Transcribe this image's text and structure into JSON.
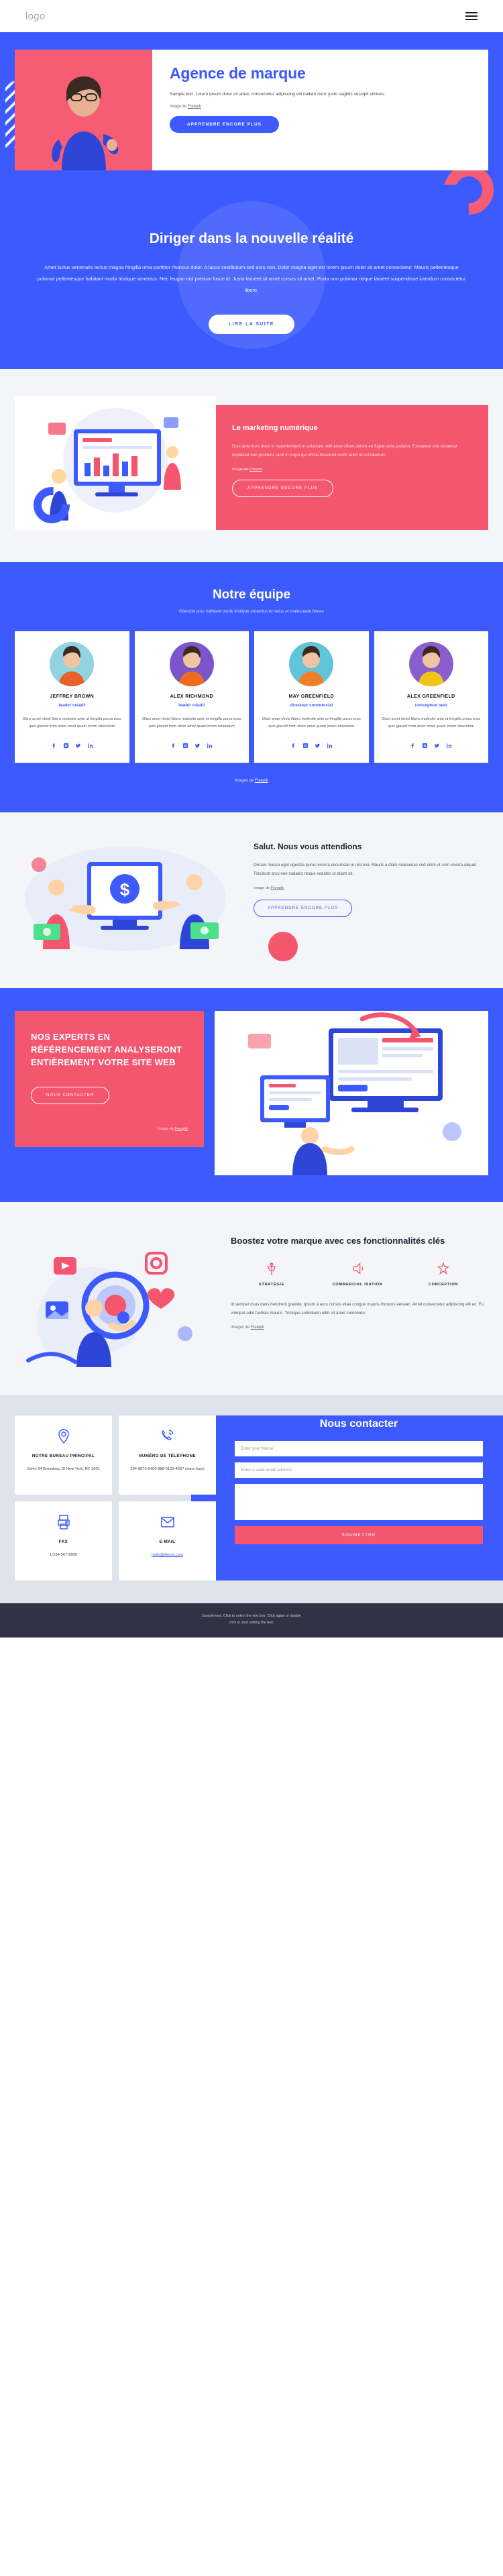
{
  "nav": {
    "logo": "logo",
    "menu_icon": "hamburger-icon"
  },
  "hero": {
    "title": "Agence de marque",
    "paragraph": "Sample text. Lorem ipsum dolor sit amet, consectetur adipiscing elit nullam nunc justo sagittis suscipit ultrices.",
    "credit_prefix": "Image de ",
    "credit_link": "Freepik",
    "cta": "APPRENDRE ENCORE PLUS"
  },
  "lead": {
    "title": "Diriger dans la nouvelle réalité",
    "paragraph": "Amet luctus venenatis lectus magna fringilla urna porttitor rhoncus dolor. A lacus vestibulum sed arcu non. Dolor magna eget est lorem ipsum dolor sit amet consectetur. Mauris pellentesque pulvinar pellentesque habitant morbi tristique senectus. Nec feugiat nisl pretium fusce id. Justo laoreet sit amet cursus sit amet. Porta non pulvinar neque laoreet suspendisse interdum consectetur libero.",
    "cta": "LIRE LA SUITE"
  },
  "marketing": {
    "title": "Le marketing numérique",
    "paragraph": "Duis aute irure dolor in reprehenderit in voluptate velit esse cillum dolore eu fugiat nulla pariatur. Excepteur sint occaecat cupidatat non proident, sunt in culpa qui officia deserunt mollit anim id est laborum.",
    "credit_prefix": "Image de ",
    "credit_link": "Freepik",
    "cta": "APPRENDRE ENCORE PLUS"
  },
  "team": {
    "title": "Notre équipe",
    "subtitle": "Glavrida pour habitant morbi tristique senectus et netus et malesuada fames",
    "credit_prefix": "Images de ",
    "credit_link": "Freepik",
    "members": [
      {
        "name": "JEFFREY BROWN",
        "role": "leader créatif",
        "bio": "Glavi amet ritnisl libero molestie ante ut fringilla purus eros quis glavrid from dolor amet quam lorem bibendum",
        "shirt": "#e8622b",
        "bg": "#8fd4e0"
      },
      {
        "name": "ALEX RICHMOND",
        "role": "leader créatif",
        "bio": "Glavi amet ritnisl libero molestie ante ut fringilla purus eros quis glavrid from dolor amet quam lorem bibendum",
        "shirt": "#ef6b1e",
        "bg": "#7b55c9"
      },
      {
        "name": "MAY GREENFIELD",
        "role": "directeur commercial",
        "bio": "Glavi amet ritnisl libero molestie ante ut fringilla purus eros quis glavrid from dolor amet quam lorem bibendum",
        "shirt": "#f07f2a",
        "bg": "#62c4d8"
      },
      {
        "name": "ALEX GREENFIELD",
        "role": "concepteur web",
        "bio": "Glavi amet ritnisl libero molestie ante ut fringilla purus eros quis glavrid from dolor amet quam lorem bibendum",
        "shirt": "#f0c419",
        "bg": "#8b5ed0"
      }
    ],
    "social_icons": [
      "facebook-icon",
      "instagram-icon",
      "twitter-icon",
      "linkedin-icon"
    ]
  },
  "salut": {
    "title": "Salut. Nous vous attendions",
    "paragraph": "Ornare massa eget egestas purus viverra accumsan in nisl nisi. Mauris a diam maecenas sed enim ut sem viverra aliquet. Tincidunt arcu non sodales neque sodales ut etiam sit.",
    "credit_prefix": "Image de ",
    "credit_link": "Freepik",
    "cta": "APPRENDRE ENCORE PLUS"
  },
  "seo": {
    "title": "NOS EXPERTS EN RÉFÉRENCEMENT ANALYSERONT ENTIÈREMENT VOTRE SITE WEB",
    "cta": "NOUS CONTACTER",
    "credit_prefix": "Image de ",
    "credit_link": "Freepik"
  },
  "features": {
    "title": "Boostez votre marque avec ces fonctionnalités clés",
    "items": [
      {
        "label": "STRATÉGIE",
        "icon": "strategy-icon"
      },
      {
        "label": "COMMERCIAL ISATION",
        "icon": "marketing-icon"
      },
      {
        "label": "CONCEPTION",
        "icon": "design-icon"
      }
    ],
    "paragraph": "Id semper risus dans hendrerit gravida. Ipsum a arcu cursus vitae congue mauris rhoncus aenean. Amet consectetur adipiscing elit ac. Eu volutpat odio facilisis mauris. Tristique sollicitudin nibh sit amet commodo.",
    "credit_prefix": "Images de ",
    "credit_link": "Freepik"
  },
  "contact": {
    "title": "Nous contacter",
    "cards": [
      {
        "icon": "location-pin-icon",
        "heading": "NOTRE BUREAU PRINCIPAL",
        "value": "SoHo 94 Broadway St New York, NY 1001"
      },
      {
        "icon": "phone-icon",
        "heading": "NUMÉRO DE TÉLÉPHONE",
        "value": "234-9876-5400 888-0123-4567 (sans frais)"
      },
      {
        "icon": "printer-icon",
        "heading": "FAX",
        "value": "1-234-567-8900"
      },
      {
        "icon": "envelope-icon",
        "heading": "E-MAIL",
        "value": "hello@theme.com",
        "is_link": true
      }
    ],
    "form": {
      "name_placeholder": "Enter your Name",
      "email_placeholder": "Enter a valid email address",
      "message_placeholder": "",
      "submit": "SOUMETTRE"
    }
  },
  "footer": {
    "line1": "Sample text. Click to select the text box. Click again or double",
    "line2": "click to start editing the text."
  },
  "colors": {
    "blue": "#3d5afe",
    "pink": "#f4566f",
    "light": "#f4f5f9",
    "dark": "#2f3343"
  }
}
